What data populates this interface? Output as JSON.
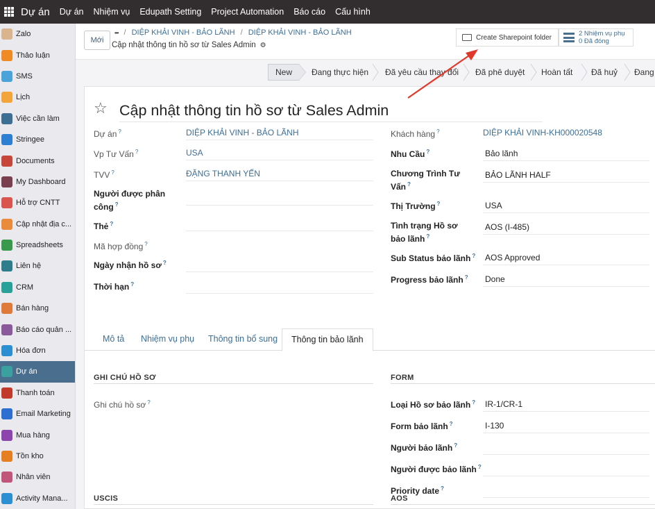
{
  "topbar": {
    "brand": "Dự án",
    "menu": [
      "Dự án",
      "Nhiệm vụ",
      "Edupath Setting",
      "Project Automation",
      "Báo cáo",
      "Cấu hình"
    ]
  },
  "sidebar": {
    "items": [
      {
        "label": "Zalo",
        "icon": "zalo-icon",
        "color": "#d9b48c"
      },
      {
        "label": "Thảo luận",
        "icon": "discuss-icon",
        "color": "#f08a24"
      },
      {
        "label": "SMS",
        "icon": "sms-icon",
        "color": "#4aa3d9"
      },
      {
        "label": "Lịch",
        "icon": "calendar-icon",
        "color": "#f3a53b"
      },
      {
        "label": "Việc cần làm",
        "icon": "todo-icon",
        "color": "#3d6f94"
      },
      {
        "label": "Stringee",
        "icon": "stringee-icon",
        "color": "#2c7fd1"
      },
      {
        "label": "Documents",
        "icon": "documents-icon",
        "color": "#c7463b"
      },
      {
        "label": "My Dashboard",
        "icon": "dashboard-icon",
        "color": "#7a3f4e"
      },
      {
        "label": "Hỗ trợ CNTT",
        "icon": "helpdesk-icon",
        "color": "#d9534f"
      },
      {
        "label": "Cập nhật địa c...",
        "icon": "address-icon",
        "color": "#e98b3a"
      },
      {
        "label": "Spreadsheets",
        "icon": "spreadsheet-icon",
        "color": "#3a9a4b"
      },
      {
        "label": "Liên hệ",
        "icon": "contacts-icon",
        "color": "#2e7d8c"
      },
      {
        "label": "CRM",
        "icon": "crm-icon",
        "color": "#2aa198"
      },
      {
        "label": "Bán hàng",
        "icon": "sales-icon",
        "color": "#e07a3a"
      },
      {
        "label": "Báo cáo quản ...",
        "icon": "report-icon",
        "color": "#8a5a9a"
      },
      {
        "label": "Hóa đơn",
        "icon": "invoice-icon",
        "color": "#2c8fd1"
      },
      {
        "label": "Dự án",
        "icon": "project-icon",
        "color": "#3aa0a0",
        "active": true
      },
      {
        "label": "Thanh toán",
        "icon": "payment-icon",
        "color": "#c0392b"
      },
      {
        "label": "Email Marketing",
        "icon": "email-marketing-icon",
        "color": "#2c6fd1"
      },
      {
        "label": "Mua hàng",
        "icon": "purchase-icon",
        "color": "#8e44ad"
      },
      {
        "label": "Tồn kho",
        "icon": "inventory-icon",
        "color": "#e67e22"
      },
      {
        "label": "Nhân viên",
        "icon": "employees-icon",
        "color": "#c0567a"
      },
      {
        "label": "Activity Mana...",
        "icon": "activity-icon",
        "color": "#2c8fd1"
      }
    ]
  },
  "control": {
    "new_label": "Mới",
    "ellipsis": "•••",
    "breadcrumb": [
      "DIỆP KHẢI VINH - BẢO LÃNH",
      "DIỆP KHẢI VINH - BẢO LÃNH"
    ],
    "record_title": "Cập nhật thông tin hồ sơ từ Sales Admin",
    "sharepoint_label": "Create Sharepoint folder",
    "subtasks_line1": "2 Nhiệm vụ phụ",
    "subtasks_line2": "0 Đã đóng"
  },
  "stages": [
    "New",
    "Đang thực hiện",
    "Đã yêu cầu thay đổi",
    "Đã phê duyệt",
    "Hoàn tất",
    "Đã huỷ",
    "Đang"
  ],
  "form": {
    "title": "Cập nhật thông tin hồ sơ từ Sales Admin",
    "left": [
      {
        "label": "Dự án",
        "value": "DIỆP KHẢI VINH - BẢO LÃNH"
      },
      {
        "label": "Vp Tư Vấn",
        "value": "USA"
      },
      {
        "label": "TVV",
        "value": "ĐẶNG THANH YẾN"
      },
      {
        "label": "Người được phân công",
        "value": ""
      },
      {
        "label": "Thẻ",
        "value": ""
      },
      {
        "label": "Mã hợp đồng",
        "value": ""
      },
      {
        "label": "Ngày nhận hồ sơ",
        "value": ""
      },
      {
        "label": "Thời hạn",
        "value": ""
      }
    ],
    "right": [
      {
        "label": "Khách hàng",
        "value": "DIỆP KHẢI VINH-KH000020548"
      },
      {
        "label": "Nhu Cầu",
        "value": "Bảo lãnh"
      },
      {
        "label": "Chương Trình Tư Vấn",
        "value": "BẢO LÃNH HALF"
      },
      {
        "label": "Thị Trường",
        "value": "USA"
      },
      {
        "label": "Tình trạng Hồ sơ bảo lãnh",
        "value": "AOS (I-485)"
      },
      {
        "label": "Sub Status bảo lãnh",
        "value": "AOS Approved"
      },
      {
        "label": "Progress bảo lãnh",
        "value": "Done"
      }
    ]
  },
  "tabs": [
    "Mô tả",
    "Nhiệm vụ phụ",
    "Thông tin bổ sung",
    "Thông tin bảo lãnh"
  ],
  "sections": {
    "notes_title": "GHI CHÚ HỒ SƠ",
    "notes_label": "Ghi chú hồ sơ",
    "form_title": "FORM",
    "form_fields": [
      {
        "label": "Loại Hồ sơ bảo lãnh",
        "value": "IR-1/CR-1"
      },
      {
        "label": "Form bảo lãnh",
        "value": "I-130"
      },
      {
        "label": "Người bảo lãnh",
        "value": ""
      },
      {
        "label": "Người được bảo lãnh",
        "value": ""
      },
      {
        "label": "Priority date",
        "value": ""
      }
    ],
    "uscis_title": "USCIS",
    "aos_title": "AOS"
  },
  "help_mark": "?"
}
